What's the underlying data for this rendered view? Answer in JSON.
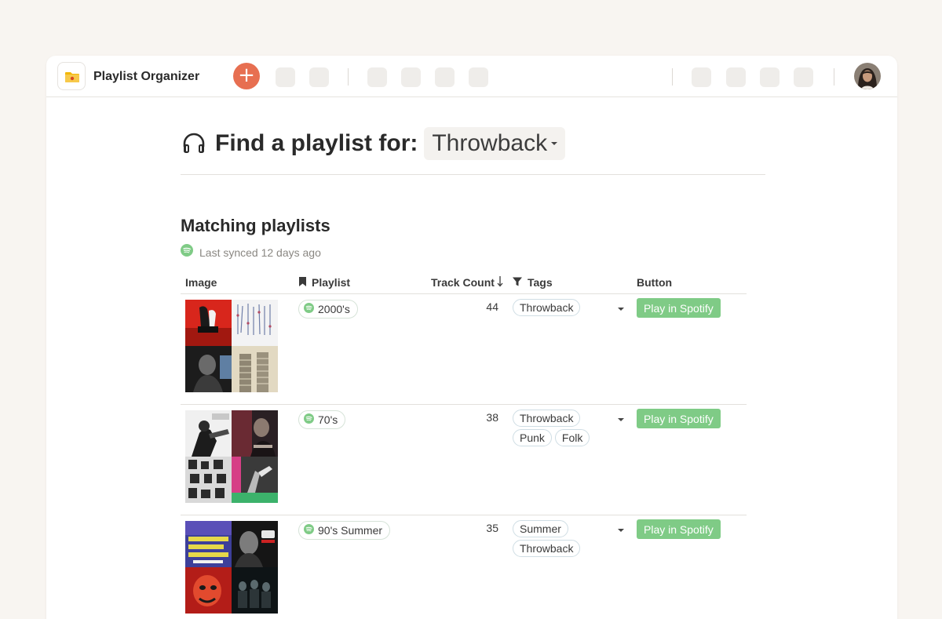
{
  "app": {
    "title": "Playlist Organizer",
    "icon": "folder-icon",
    "add_icon": "+"
  },
  "colors": {
    "accent": "#e76f51",
    "spotify_green": "#7fcb86",
    "background": "#f8f5f1"
  },
  "page": {
    "heading_prefix": "Find a playlist for:",
    "selected_filter": "Throwback",
    "section_title": "Matching playlists",
    "sync_status": "Last synced 12 days ago"
  },
  "table": {
    "columns": {
      "image": "Image",
      "playlist": "Playlist",
      "track_count": "Track Count",
      "tags": "Tags",
      "button": "Button"
    },
    "rows": [
      {
        "playlist": "2000's",
        "track_count": "44",
        "tags": [
          "Throwback"
        ],
        "button": "Play in Spotify"
      },
      {
        "playlist": "70's",
        "track_count": "38",
        "tags": [
          "Throwback",
          "Punk",
          "Folk"
        ],
        "button": "Play in Spotify"
      },
      {
        "playlist": "90's Summer",
        "track_count": "35",
        "tags": [
          "Summer",
          "Throwback"
        ],
        "button": "Play in Spotify"
      }
    ]
  }
}
